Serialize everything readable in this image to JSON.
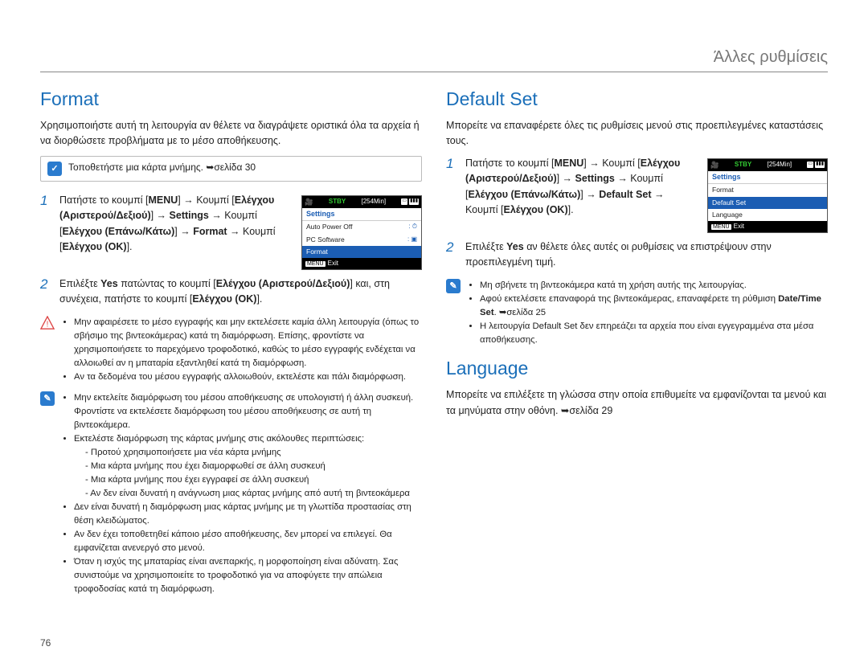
{
  "page": {
    "header": "Άλλες ρυθμίσεις",
    "number": "76"
  },
  "left": {
    "title": "Format",
    "intro": "Χρησιμοποιήστε αυτή τη λειτουργία αν θέλετε να διαγράψετε οριστικά όλα τα αρχεία ή να διορθώσετε προβλήματα με το μέσο αποθήκευσης.",
    "tip": "Τοποθετήστε μια κάρτα μνήμης. ➥σελίδα 30",
    "step1_a": "Πατήστε το κουμπί [",
    "step1_b": "MENU",
    "step1_c": "] → Κουμπί [",
    "step1_d": "Ελέγχου (Αριστερού/Δεξιού)",
    "step1_e": "] → ",
    "step1_f": "Settings",
    "step1_g": " → Κουμπί [",
    "step1_h": "Ελέγχου (Επάνω/Κάτω)",
    "step1_i": "] → ",
    "step1_j": "Format",
    "step1_k": " → Κουμπί [",
    "step1_l": "Ελέγχου (OK)",
    "step1_m": "].",
    "step2_a": "Επιλέξτε ",
    "step2_b": "Yes",
    "step2_c": " πατώντας το κουμπί [",
    "step2_d": "Ελέγχου (Αριστερού/Δεξιού)",
    "step2_e": "] και, στη συνέχεια, πατήστε το κουμπί [",
    "step2_f": "Ελέγχου (OK)",
    "step2_g": "].",
    "warn1": "Μην αφαιρέσετε το μέσο εγγραφής και μην εκτελέσετε καμία άλλη λειτουργία (όπως το σβήσιμο της βιντεοκάμερας) κατά τη διαμόρφωση. Επίσης, φροντίστε να χρησιμοποιήσετε το παρεχόμενο τροφοδοτικό, καθώς το μέσο εγγραφής ενδέχεται να αλλοιωθεί αν η μπαταρία εξαντληθεί κατά τη διαμόρφωση.",
    "warn2": "Αν τα δεδομένα του μέσου εγγραφής αλλοιωθούν, εκτελέστε και πάλι διαμόρφωση.",
    "note_a": "Μην εκτελείτε διαμόρφωση του μέσου αποθήκευσης σε υπολογιστή ή άλλη συσκευή. Φροντίστε να εκτελέσετε διαμόρφωση του μέσου αποθήκευσης σε αυτή τη βιντεοκάμερα.",
    "note_b": "Εκτελέστε διαμόρφωση της κάρτας μνήμης στις ακόλουθες περιπτώσεις:",
    "note_b1": "Προτού χρησιμοποιήσετε μια νέα κάρτα μνήμης",
    "note_b2": "Μια κάρτα μνήμης που έχει διαμορφωθεί σε άλλη συσκευή",
    "note_b3": "Μια κάρτα μνήμης που έχει εγγραφεί σε άλλη συσκευή",
    "note_b4": "Αν δεν είναι δυνατή η ανάγνωση μιας κάρτας μνήμης από αυτή τη βιντεοκάμερα",
    "note_c": "Δεν είναι δυνατή η διαμόρφωση μιας κάρτας μνήμης με τη γλωττίδα προστασίας στη θέση κλειδώματος.",
    "note_d": "Αν δεν έχει τοποθετηθεί κάποιο μέσο αποθήκευσης, δεν μπορεί να επιλεγεί. Θα εμφανίζεται ανενεργό στο μενού.",
    "note_e": "Όταν η ισχύς της μπαταρίας είναι ανεπαρκής, η μορφοποίηση είναι αδύνατη. Σας συνιστούμε να χρησιμοποιείτε το τροφοδοτικό για να αποφύγετε την απώλεια τροφοδοσίας κατά τη διαμόρφωση.",
    "lcd": {
      "stby": "STBY",
      "time": "[254Min]",
      "header": "Settings",
      "rows": [
        {
          "label": "Auto Power Off",
          "val": "⏱"
        },
        {
          "label": "PC Software",
          "val": "▣"
        },
        {
          "label": "Format",
          "val": "",
          "sel": true
        }
      ],
      "exit_label": "Exit",
      "menu_label": "MENU"
    }
  },
  "right": {
    "title1": "Default Set",
    "intro1": "Μπορείτε να επαναφέρετε όλες τις ρυθμίσεις μενού στις προεπιλεγμένες καταστάσεις τους.",
    "step1_a": "Πατήστε το κουμπί [",
    "step1_b": "MENU",
    "step1_c": "] → Κουμπί [",
    "step1_d": "Ελέγχου (Αριστερού/Δεξιού)",
    "step1_e": "] → ",
    "step1_f": "Settings",
    "step1_g": " → Κουμπί [",
    "step1_h": "Ελέγχου (Επάνω/Κάτω)",
    "step1_i": "] → ",
    "step1_j": "Default Set",
    "step1_k": " → Κουμπί [",
    "step1_l": "Ελέγχου (OK)",
    "step1_m": "].",
    "step2_a": "Επιλέξτε ",
    "step2_b": "Yes",
    "step2_c": " αν θέλετε όλες αυτές οι ρυθμίσεις να επιστρέψουν στην προεπιλεγμένη τιμή.",
    "note1": "Μη σβήνετε τη βιντεοκάμερα κατά τη χρήση αυτής της λειτουργίας.",
    "note2_a": "Αφού εκτελέσετε επαναφορά της βιντεοκάμερας, επαναφέρετε τη ρύθμιση ",
    "note2_b": "Date/Time Set",
    "note2_c": ". ➥σελίδα 25",
    "note3": "Η λειτουργία Default Set δεν επηρεάζει τα αρχεία που είναι εγγεγραμμένα στα μέσα αποθήκευσης.",
    "lcd": {
      "stby": "STBY",
      "time": "[254Min]",
      "header": "Settings",
      "rows": [
        {
          "label": "Format",
          "val": ""
        },
        {
          "label": "Default Set",
          "val": "",
          "sel": true
        },
        {
          "label": "Language",
          "val": ""
        }
      ],
      "exit_label": "Exit",
      "menu_label": "MENU"
    },
    "title2": "Language",
    "lang_a": "Μπορείτε να επιλέξετε τη γλώσσα στην οποία επιθυμείτε να εμφανίζονται τα μενού και τα μηνύματα στην οθόνη. ➥σελίδα 29"
  }
}
